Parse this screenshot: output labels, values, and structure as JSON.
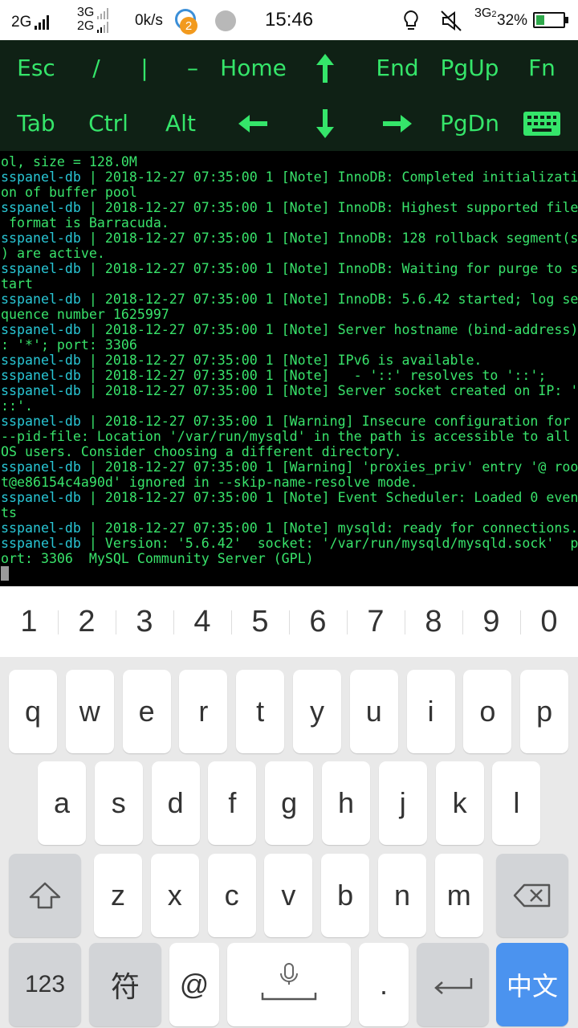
{
  "status_bar": {
    "net1_label": "2G",
    "net2_label_top": "3G",
    "net2_label_bottom": "2G",
    "speed": "0k/s",
    "notif_badge": "2",
    "time": "15:46",
    "net3_label": "3G",
    "net3_sub": "2",
    "battery_percent": "32%",
    "battery_level": 0.32
  },
  "extra_keys": {
    "row1": [
      "Esc",
      "/",
      "|",
      "–",
      "Home",
      "↑",
      "End",
      "PgUp",
      "Fn"
    ],
    "row2": [
      "Tab",
      "Ctrl",
      "Alt",
      "←",
      "↓",
      "→",
      "PgDn"
    ],
    "keyboard_toggle_icon": "keyboard-icon"
  },
  "terminal": {
    "lines": [
      {
        "host": "",
        "text": "ol, size = 128.0M"
      },
      {
        "host": "sspanel-db",
        "text": " | 2018-12-27 07:35:00 1 [Note] InnoDB: Completed initializati"
      },
      {
        "host": "",
        "text": "on of buffer pool"
      },
      {
        "host": "sspanel-db",
        "text": " | 2018-12-27 07:35:00 1 [Note] InnoDB: Highest supported file"
      },
      {
        "host": "",
        "text": " format is Barracuda."
      },
      {
        "host": "sspanel-db",
        "text": " | 2018-12-27 07:35:00 1 [Note] InnoDB: 128 rollback segment(s"
      },
      {
        "host": "",
        "text": ") are active."
      },
      {
        "host": "sspanel-db",
        "text": " | 2018-12-27 07:35:00 1 [Note] InnoDB: Waiting for purge to s"
      },
      {
        "host": "",
        "text": "tart"
      },
      {
        "host": "sspanel-db",
        "text": " | 2018-12-27 07:35:00 1 [Note] InnoDB: 5.6.42 started; log se"
      },
      {
        "host": "",
        "text": "quence number 1625997"
      },
      {
        "host": "sspanel-db",
        "text": " | 2018-12-27 07:35:00 1 [Note] Server hostname (bind-address)"
      },
      {
        "host": "",
        "text": ": '*'; port: 3306"
      },
      {
        "host": "sspanel-db",
        "text": " | 2018-12-27 07:35:00 1 [Note] IPv6 is available."
      },
      {
        "host": "sspanel-db",
        "text": " | 2018-12-27 07:35:00 1 [Note]   - '::' resolves to '::';"
      },
      {
        "host": "sspanel-db",
        "text": " | 2018-12-27 07:35:00 1 [Note] Server socket created on IP: '"
      },
      {
        "host": "",
        "text": "::'."
      },
      {
        "host": "sspanel-db",
        "text": " | 2018-12-27 07:35:00 1 [Warning] Insecure configuration for"
      },
      {
        "host": "",
        "text": "--pid-file: Location '/var/run/mysqld' in the path is accessible to all"
      },
      {
        "host": "",
        "text": "OS users. Consider choosing a different directory."
      },
      {
        "host": "sspanel-db",
        "text": " | 2018-12-27 07:35:00 1 [Warning] 'proxies_priv' entry '@ roo"
      },
      {
        "host": "",
        "text": "t@e86154c4a90d' ignored in --skip-name-resolve mode."
      },
      {
        "host": "sspanel-db",
        "text": " | 2018-12-27 07:35:00 1 [Note] Event Scheduler: Loaded 0 even"
      },
      {
        "host": "",
        "text": "ts"
      },
      {
        "host": "sspanel-db",
        "text": " | 2018-12-27 07:35:00 1 [Note] mysqld: ready for connections."
      },
      {
        "host": "sspanel-db",
        "text": " | Version: '5.6.42'  socket: '/var/run/mysqld/mysqld.sock'  p"
      },
      {
        "host": "",
        "text": "ort: 3306  MySQL Community Server (GPL)"
      }
    ]
  },
  "keyboard": {
    "numbers": [
      "1",
      "2",
      "3",
      "4",
      "5",
      "6",
      "7",
      "8",
      "9",
      "0"
    ],
    "row1": [
      "q",
      "w",
      "e",
      "r",
      "t",
      "y",
      "u",
      "i",
      "o",
      "p"
    ],
    "row2": [
      "a",
      "s",
      "d",
      "f",
      "g",
      "h",
      "j",
      "k",
      "l"
    ],
    "row3": [
      "z",
      "x",
      "c",
      "v",
      "b",
      "n",
      "m"
    ],
    "key_123": "123",
    "key_symbols": "符",
    "key_at": "@",
    "key_period": ".",
    "key_lang": "中文",
    "colors": {
      "accent": "#4b93ef",
      "terminal_green": "#39e36b",
      "terminal_cyan": "#29c7d6"
    }
  }
}
